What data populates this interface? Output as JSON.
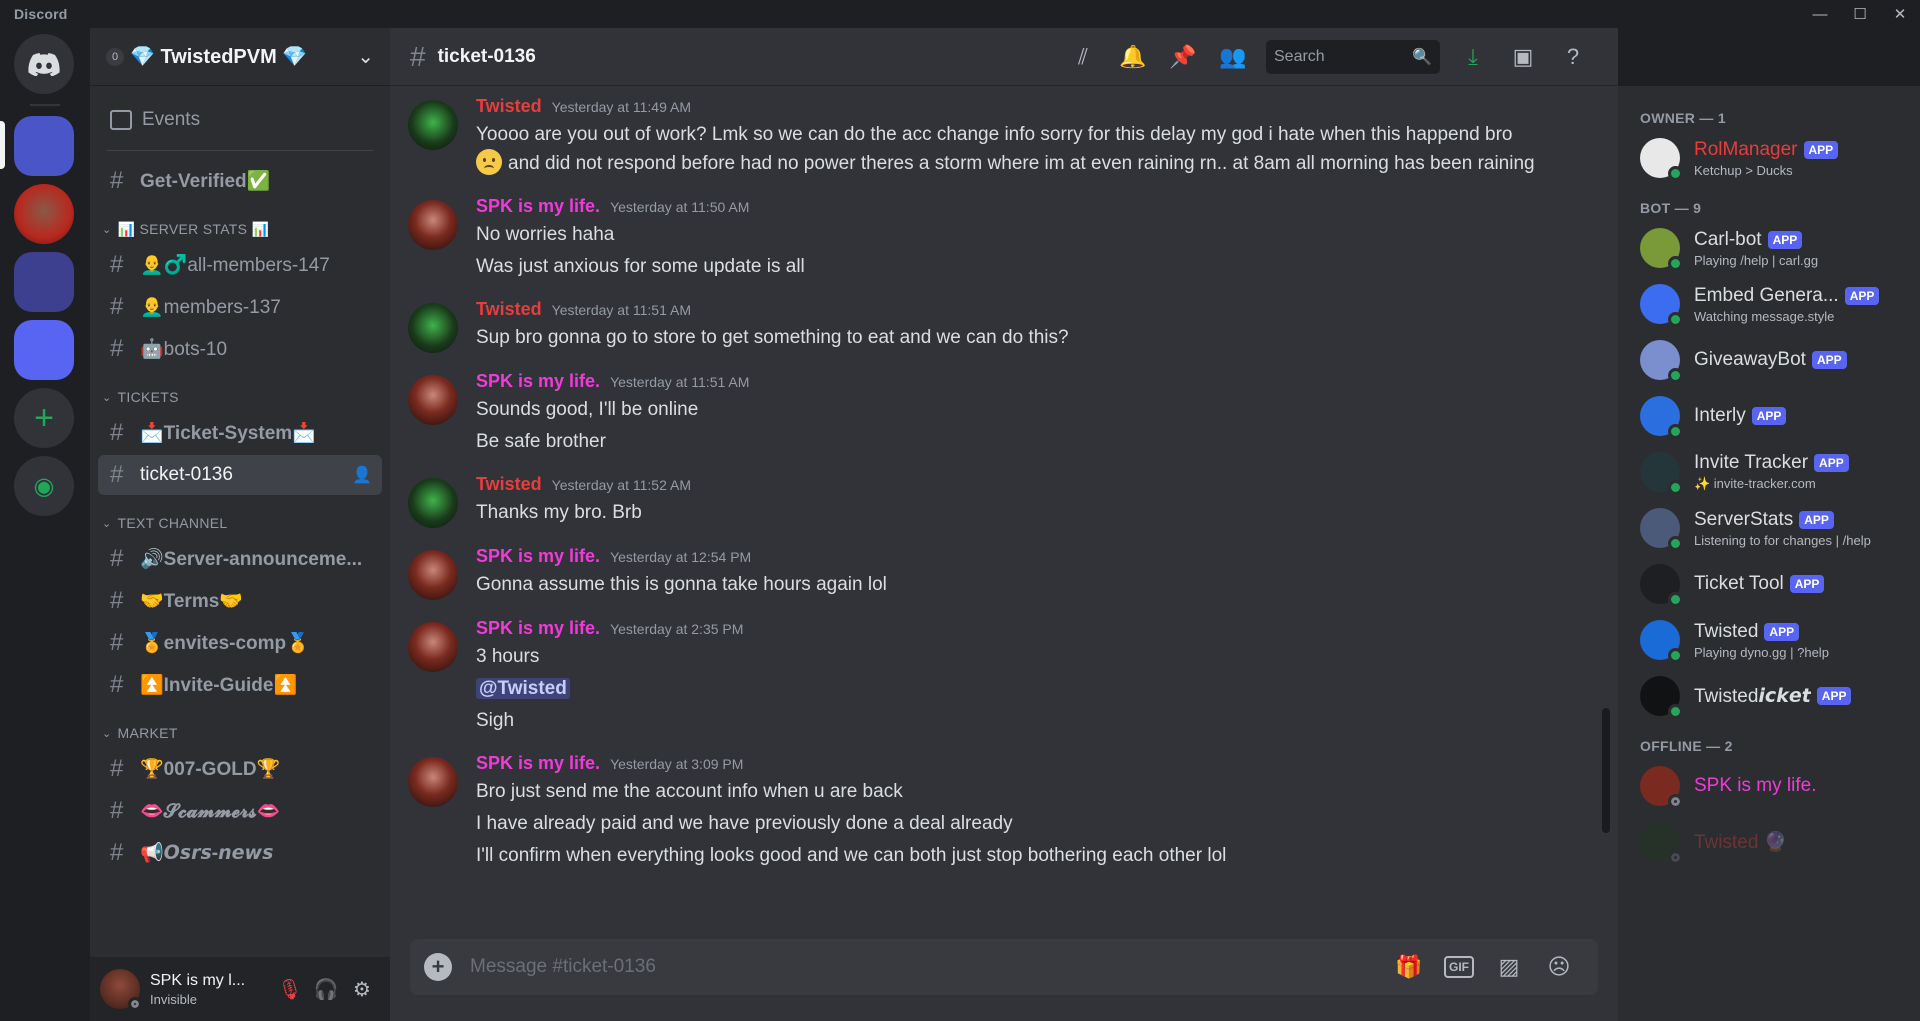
{
  "window": {
    "brand": "Discord"
  },
  "server": {
    "name": "💎 TwistedPVM 💎",
    "notif_count": "0"
  },
  "sidebar": {
    "events_label": "Events",
    "top_channel": "Get-Verified✅",
    "categories": [
      {
        "name": "📊 SERVER STATS 📊",
        "channels": [
          "👨‍🦲♂️all-members-147",
          "👨‍🦲members-137",
          "🤖bots-10"
        ]
      },
      {
        "name": "TICKETS",
        "channels": [
          "📩Ticket-System📩",
          "ticket-0136"
        ]
      },
      {
        "name": "TEXT CHANNEL",
        "channels": [
          "🔊Server-announceme...",
          "🤝Terms🤝",
          "🏅envites-comp🏅",
          "⏫Invite-Guide⏫"
        ]
      },
      {
        "name": "MARKET",
        "channels": [
          "🏆007-GOLD🏆",
          "👄𝓢𝓬𝓪𝓶𝓶𝓮𝓻𝓼👄",
          "📢𝙊𝙨𝙧𝙨-𝙣𝙚𝙬𝙨"
        ]
      }
    ]
  },
  "user": {
    "name": "SPK is my l...",
    "status": "Invisible"
  },
  "channel": {
    "name": "ticket-0136",
    "search_placeholder": "Search",
    "composer_placeholder": "Message #ticket-0136"
  },
  "messages": [
    {
      "author": "Twisted",
      "kind": "twisted",
      "time": "Yesterday at 11:49 AM",
      "lines": [
        "Yoooo are you out of work? Lmk so we can do the acc change info sorry for this delay my god i hate when this happend bro",
        "and did not respond before had no power theres a storm where im at even raining rn.. at 8am all morning has been raining"
      ]
    },
    {
      "author": "SPK is my life.",
      "kind": "spk",
      "time": "Yesterday at 11:50 AM",
      "lines": [
        "No worries haha",
        "Was just anxious for some update is all"
      ]
    },
    {
      "author": "Twisted",
      "kind": "twisted",
      "time": "Yesterday at 11:51 AM",
      "lines": [
        "Sup bro gonna go to store to get something to eat and we can do this?"
      ]
    },
    {
      "author": "SPK is my life.",
      "kind": "spk",
      "time": "Yesterday at 11:51 AM",
      "lines": [
        "Sounds good, I'll be online",
        "Be safe brother"
      ]
    },
    {
      "author": "Twisted",
      "kind": "twisted",
      "time": "Yesterday at 11:52 AM",
      "lines": [
        "Thanks my bro. Brb"
      ]
    },
    {
      "author": "SPK is my life.",
      "kind": "spk",
      "time": "Yesterday at 12:54 PM",
      "lines": [
        "Gonna assume this is gonna take hours again lol"
      ]
    },
    {
      "author": "SPK is my life.",
      "kind": "spk",
      "time": "Yesterday at 2:35 PM",
      "lines": [
        "3 hours",
        "@Twisted",
        "Sigh"
      ]
    },
    {
      "author": "SPK is my life.",
      "kind": "spk",
      "time": "Yesterday at 3:09 PM",
      "lines": [
        "Bro just send me the account info when u are back",
        "I have already paid and we have previously done a deal already",
        "I'll confirm when everything looks good and we can both just stop bothering each other lol"
      ]
    }
  ],
  "members": {
    "groups": [
      {
        "label": "Owner — 1",
        "items": [
          {
            "name": "RolManager",
            "sub": "Ketchup > Ducks",
            "app": "APP",
            "color": "#e83d3d",
            "avatar": "#e8e8e8"
          }
        ]
      },
      {
        "label": "BOT — 9",
        "items": [
          {
            "name": "Carl-bot",
            "sub": "Playing /help | carl.gg",
            "app": "APP",
            "avatar": "#7a9a3a"
          },
          {
            "name": "Embed Genera...",
            "sub": "Watching message.style",
            "app": "APP",
            "avatar": "#3c6df0"
          },
          {
            "name": "GiveawayBot",
            "sub": "",
            "app": "APP",
            "avatar": "#7b8fcf"
          },
          {
            "name": "Interly",
            "sub": "",
            "app": "APP",
            "avatar": "#2a6ee0"
          },
          {
            "name": "Invite Tracker",
            "sub": "✨ invite-tracker.com",
            "app": "APP",
            "avatar": "#24363a"
          },
          {
            "name": "ServerStats",
            "sub": "Listening to for changes | /help",
            "app": "APP",
            "avatar": "#4a5a78"
          },
          {
            "name": "Ticket Tool",
            "sub": "",
            "app": "APP",
            "avatar": "#1e1f22"
          },
          {
            "name": "Twisted",
            "sub": "Playing dyno.gg | ?help",
            "app": "APP",
            "avatar": "#1a6ad8"
          },
          {
            "name": "Twisted𝙞𝙘𝙠𝙚𝙩",
            "sub": "",
            "app": "APP",
            "avatar": "#111214"
          }
        ]
      },
      {
        "label": "OFFLINE — 2",
        "items": [
          {
            "name": "SPK is my life.",
            "sub": "",
            "app": "",
            "color": "#ef3bd8",
            "avatar": "#7a2a1f",
            "offline": true
          },
          {
            "name": "Twisted 🔮",
            "sub": "",
            "app": "",
            "color": "#e83d3d",
            "avatar": "#1a3b1b",
            "offline": true,
            "dim": true
          }
        ]
      }
    ]
  }
}
